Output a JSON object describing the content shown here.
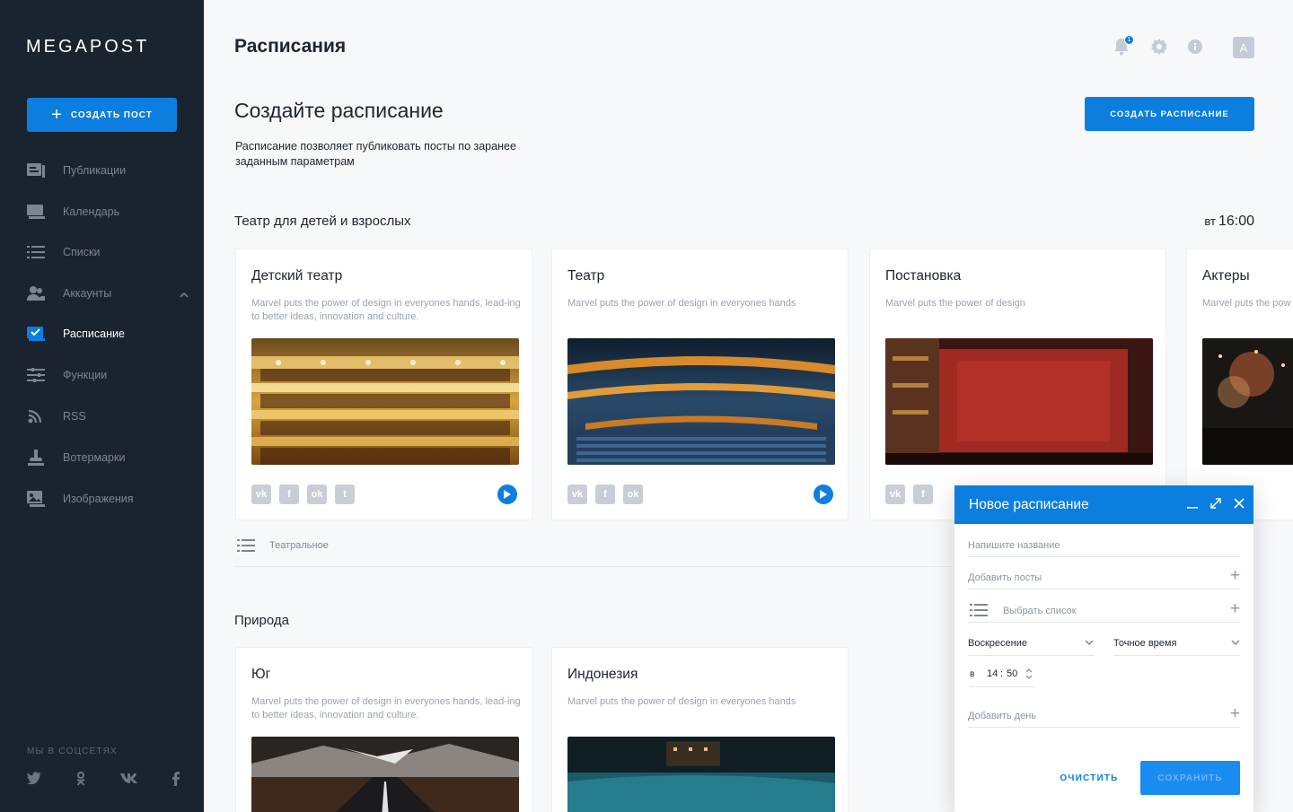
{
  "sidebar": {
    "logo": "MEGAPOST",
    "create_post_label": "создать пост",
    "items": [
      {
        "label": "Публикации",
        "icon": "publications-icon",
        "active": false
      },
      {
        "label": "Календарь",
        "icon": "calendar-icon",
        "active": false
      },
      {
        "label": "Списки",
        "icon": "list-icon",
        "active": false
      },
      {
        "label": "Аккаунты",
        "icon": "accounts-icon",
        "active": false
      },
      {
        "label": "Расписание",
        "icon": "schedule-icon",
        "active": true
      },
      {
        "label": "Функции",
        "icon": "functions-icon",
        "active": false
      },
      {
        "label": "RSS",
        "icon": "rss-icon",
        "active": false
      },
      {
        "label": "Вотермарки",
        "icon": "watermark-icon",
        "active": false
      },
      {
        "label": "Изображения",
        "icon": "images-icon",
        "active": false
      }
    ],
    "social_title": "мы в соцсетях",
    "social_icons": [
      "twitter-icon",
      "odnoklassniki-icon",
      "vk-icon",
      "facebook-icon"
    ]
  },
  "header": {
    "title": "Расписания",
    "notification_count": "1",
    "avatar_letter": "A"
  },
  "intro": {
    "title": "Создайте расписание",
    "description": "Расписание позволяет публиковать посты по заранее заданным параметрам",
    "create_button": "создать расписание"
  },
  "groups": [
    {
      "title": "Театр для детей и взрослых",
      "time_prefix": "вт",
      "time": "16:00",
      "cards": [
        {
          "title": "Детский театр",
          "desc": "Marvel puts the power of design in everyones hands, lead-ing to better ideas, innovation and culture."
        },
        {
          "title": "Театр",
          "desc": "Marvel puts the power of design in everyones hands"
        },
        {
          "title": "Постановка",
          "desc": "Marvel puts the power of design"
        },
        {
          "title": "Актеры",
          "desc": "Marvel puts the pow"
        }
      ],
      "list_label": "Театральное"
    },
    {
      "title": "Природа",
      "cards": [
        {
          "title": "Юг",
          "desc": "Marvel puts the power of design in everyones hands, lead-ing to better ideas, innovation and culture."
        },
        {
          "title": "Индонезия",
          "desc": "Marvel puts the power of design in everyones hands"
        }
      ]
    }
  ],
  "modal": {
    "title": "Новое расписание",
    "name_placeholder": "Напишите название",
    "add_posts": "Добавить посты",
    "choose_list": "Выбрать список",
    "day": "Воскресение",
    "time_mode": "Точное время",
    "at": "в",
    "hours": "14",
    "minutes": "50",
    "add_day": "Добавить день",
    "clear_button": "очистить",
    "save_button": "сохранить"
  },
  "colors": {
    "accent": "#0b7ee0",
    "sidebar_bg": "#1a2330",
    "page_bg": "#f7f8fa"
  }
}
